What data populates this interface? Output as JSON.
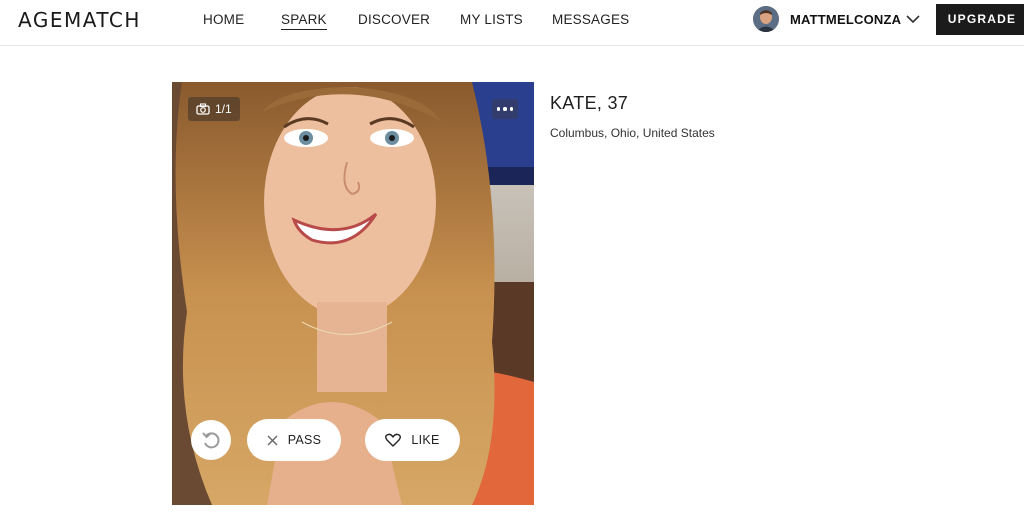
{
  "brand": {
    "logo": "AGEMATCH"
  },
  "nav": {
    "items": [
      {
        "label": "HOME",
        "active": false
      },
      {
        "label": "SPARK",
        "active": true
      },
      {
        "label": "DISCOVER",
        "active": false
      },
      {
        "label": "MY LISTS",
        "active": false
      },
      {
        "label": "MESSAGES",
        "active": false
      }
    ]
  },
  "user": {
    "username": "MATTMELCONZA",
    "upgrade_label": "UPGRADE"
  },
  "profile": {
    "name_age": "KATE, 37",
    "location": "Columbus, Ohio, United States",
    "photo_counter": "1/1",
    "pass_label": "PASS",
    "like_label": "LIKE"
  },
  "colors": {
    "upgrade_bg": "#1b1b1b",
    "top_border": "#e6e6e6",
    "shirt": "#e2683c"
  },
  "icons": {
    "counter": "camera-icon",
    "menu": "more-icon",
    "rewind": "rewind-icon",
    "pass": "close-icon",
    "like": "heart-icon",
    "user_menu": "chevron-down-icon"
  }
}
